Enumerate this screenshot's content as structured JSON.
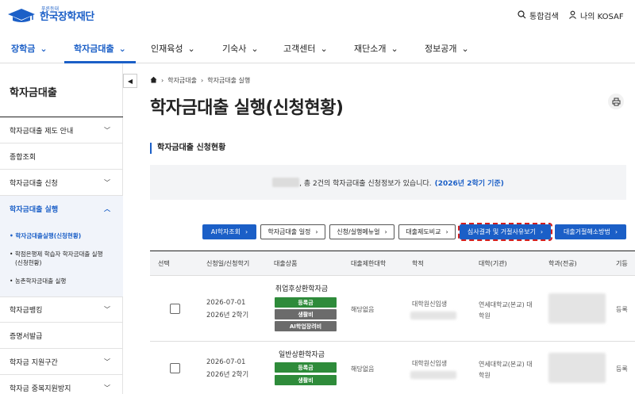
{
  "header": {
    "logo_sub": "푸른등대",
    "logo_main": "한국장학재단",
    "search_label": "통합검색",
    "my_label": "나의 KOSAF"
  },
  "gnb": [
    {
      "label": "장학금",
      "active": false
    },
    {
      "label": "학자금대출",
      "active": true
    },
    {
      "label": "인재육성",
      "active": false
    },
    {
      "label": "기숙사",
      "active": false
    },
    {
      "label": "고객센터",
      "active": false
    },
    {
      "label": "재단소개",
      "active": false
    },
    {
      "label": "정보공개",
      "active": false
    }
  ],
  "sidebar": {
    "title": "학자금대출",
    "items": [
      {
        "label": "학자금대출 제도 안내"
      },
      {
        "label": "종합조회"
      },
      {
        "label": "학자금대출 신청"
      },
      {
        "label": "학자금대출 실행"
      },
      {
        "label": "학자금뱅킹"
      },
      {
        "label": "증명서발급"
      },
      {
        "label": "학자금 지원구간"
      },
      {
        "label": "학자금 중복지원방지"
      }
    ],
    "sub_items": [
      "학자금대출실행(신청현황)",
      "학점은행제 학습자 학자금대출 실행",
      "(신청현황)",
      "농촌학자금대출 실행"
    ]
  },
  "breadcrumb": [
    "학자금대출",
    "학자금대출 실행"
  ],
  "page_title": "학자금대출 실행(신청현황)",
  "section_title": "학자금대출 신청현황",
  "notice": {
    "text": ", 총 2건의 학자금대출 신청정보가 있습니다.",
    "basis": "(2026년 2학기 기준)"
  },
  "buttons": [
    {
      "label": "AI학자조회",
      "style": "primary"
    },
    {
      "label": "학자금대출 일정",
      "style": "outline"
    },
    {
      "label": "신청/실행메뉴얼",
      "style": "outline"
    },
    {
      "label": "대출제도비교",
      "style": "outline"
    },
    {
      "label": "심사결과 및 거절사유보기",
      "style": "focus"
    },
    {
      "label": "대출거절해소방법",
      "style": "primary"
    }
  ],
  "table": {
    "headers": [
      "선택",
      "신청일/신청학기",
      "대출상품",
      "대출제한대학",
      "학적",
      "대학(기관)",
      "학과(전공)",
      "기등"
    ],
    "rows": [
      {
        "date": "2026-07-01",
        "term": "2026년 2학기",
        "product": "취업후상환학자금",
        "tags": [
          "등록금",
          "생활비",
          "AI학업장려비"
        ],
        "restricted": "해당없음",
        "status": "대학원신입생",
        "university": "연세대학교(본교) 대학원",
        "etc": "등록"
      },
      {
        "date": "2026-07-01",
        "term": "2026년 2학기",
        "product": "일반상환학자금",
        "tags": [
          "등록금",
          "생활비"
        ],
        "restricted": "해당없음",
        "status": "대학원신입생",
        "university": "연세대학교(본교) 대학원",
        "etc": "등록"
      }
    ]
  },
  "colors": {
    "brand": "#1b5fc7",
    "tag_green": "#2e8b3a",
    "tag_gray": "#6b6b6b",
    "focus_outline": "#d21f1f"
  },
  "icons": [
    "home-icon",
    "search-icon",
    "user-icon",
    "print-icon",
    "chevron-down-icon",
    "chevron-right-icon",
    "chevron-left-icon"
  ]
}
